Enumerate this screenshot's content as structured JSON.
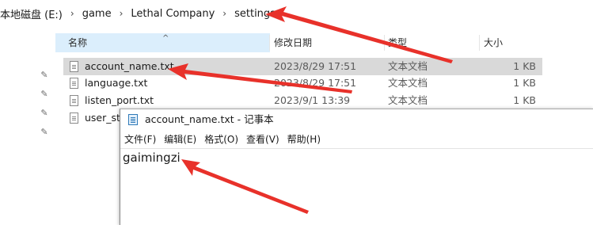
{
  "breadcrumb": [
    "本地磁盘 (E:)",
    "game",
    "Lethal Company",
    "settings"
  ],
  "columns": {
    "name": "名称",
    "date_modified": "修改日期",
    "type": "类型",
    "size": "大小"
  },
  "files": [
    {
      "name": "account_name.txt",
      "date": "2023/8/29 17:51",
      "type": "文本文档",
      "size": "1 KB",
      "selected": true
    },
    {
      "name": "language.txt",
      "date": "2023/8/29 17:51",
      "type": "文本文档",
      "size": "1 KB",
      "selected": false
    },
    {
      "name": "listen_port.txt",
      "date": "2023/9/1 13:39",
      "type": "文本文档",
      "size": "1 KB",
      "selected": false
    },
    {
      "name": "user_ste",
      "date": "",
      "type": "",
      "size": "",
      "selected": false
    }
  ],
  "notepad": {
    "title": "account_name.txt - 记事本",
    "menu": [
      "文件(F)",
      "编辑(E)",
      "格式(O)",
      "查看(V)",
      "帮助(H)"
    ],
    "content": "gaimingzi"
  },
  "colors": {
    "annotation": "#e8312a",
    "selection": "#d9d9d9",
    "header_highlight": "#dbeefc"
  }
}
